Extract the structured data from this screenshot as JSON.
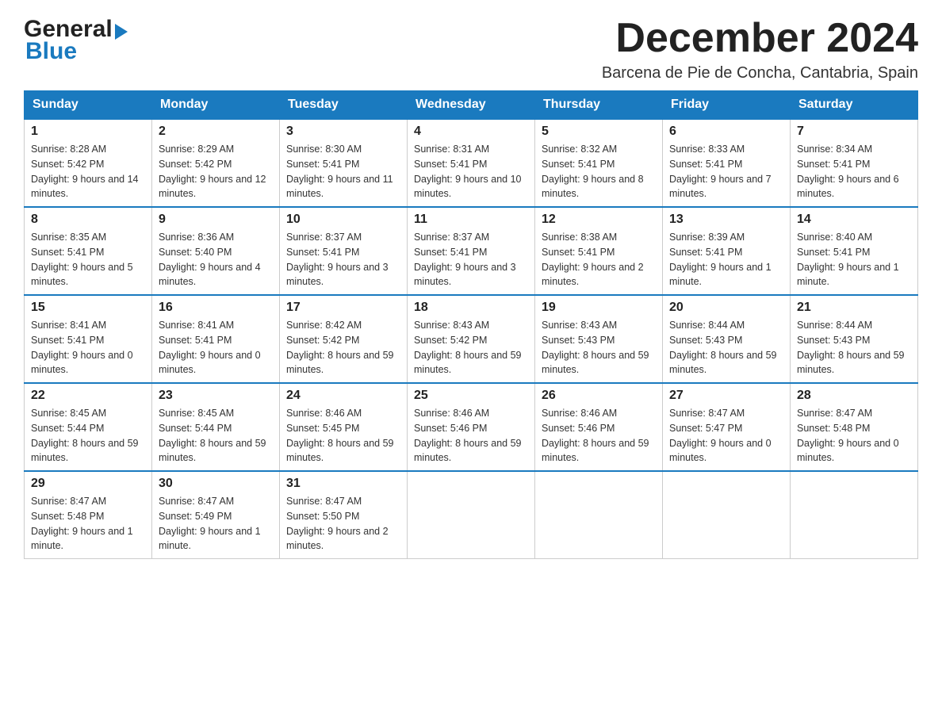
{
  "header": {
    "logo_general": "General",
    "logo_blue": "Blue",
    "month_title": "December 2024",
    "location": "Barcena de Pie de Concha, Cantabria, Spain"
  },
  "days_of_week": [
    "Sunday",
    "Monday",
    "Tuesday",
    "Wednesday",
    "Thursday",
    "Friday",
    "Saturday"
  ],
  "weeks": [
    [
      {
        "day": "1",
        "sunrise": "8:28 AM",
        "sunset": "5:42 PM",
        "daylight": "9 hours and 14 minutes."
      },
      {
        "day": "2",
        "sunrise": "8:29 AM",
        "sunset": "5:42 PM",
        "daylight": "9 hours and 12 minutes."
      },
      {
        "day": "3",
        "sunrise": "8:30 AM",
        "sunset": "5:41 PM",
        "daylight": "9 hours and 11 minutes."
      },
      {
        "day": "4",
        "sunrise": "8:31 AM",
        "sunset": "5:41 PM",
        "daylight": "9 hours and 10 minutes."
      },
      {
        "day": "5",
        "sunrise": "8:32 AM",
        "sunset": "5:41 PM",
        "daylight": "9 hours and 8 minutes."
      },
      {
        "day": "6",
        "sunrise": "8:33 AM",
        "sunset": "5:41 PM",
        "daylight": "9 hours and 7 minutes."
      },
      {
        "day": "7",
        "sunrise": "8:34 AM",
        "sunset": "5:41 PM",
        "daylight": "9 hours and 6 minutes."
      }
    ],
    [
      {
        "day": "8",
        "sunrise": "8:35 AM",
        "sunset": "5:41 PM",
        "daylight": "9 hours and 5 minutes."
      },
      {
        "day": "9",
        "sunrise": "8:36 AM",
        "sunset": "5:40 PM",
        "daylight": "9 hours and 4 minutes."
      },
      {
        "day": "10",
        "sunrise": "8:37 AM",
        "sunset": "5:41 PM",
        "daylight": "9 hours and 3 minutes."
      },
      {
        "day": "11",
        "sunrise": "8:37 AM",
        "sunset": "5:41 PM",
        "daylight": "9 hours and 3 minutes."
      },
      {
        "day": "12",
        "sunrise": "8:38 AM",
        "sunset": "5:41 PM",
        "daylight": "9 hours and 2 minutes."
      },
      {
        "day": "13",
        "sunrise": "8:39 AM",
        "sunset": "5:41 PM",
        "daylight": "9 hours and 1 minute."
      },
      {
        "day": "14",
        "sunrise": "8:40 AM",
        "sunset": "5:41 PM",
        "daylight": "9 hours and 1 minute."
      }
    ],
    [
      {
        "day": "15",
        "sunrise": "8:41 AM",
        "sunset": "5:41 PM",
        "daylight": "9 hours and 0 minutes."
      },
      {
        "day": "16",
        "sunrise": "8:41 AM",
        "sunset": "5:41 PM",
        "daylight": "9 hours and 0 minutes."
      },
      {
        "day": "17",
        "sunrise": "8:42 AM",
        "sunset": "5:42 PM",
        "daylight": "8 hours and 59 minutes."
      },
      {
        "day": "18",
        "sunrise": "8:43 AM",
        "sunset": "5:42 PM",
        "daylight": "8 hours and 59 minutes."
      },
      {
        "day": "19",
        "sunrise": "8:43 AM",
        "sunset": "5:43 PM",
        "daylight": "8 hours and 59 minutes."
      },
      {
        "day": "20",
        "sunrise": "8:44 AM",
        "sunset": "5:43 PM",
        "daylight": "8 hours and 59 minutes."
      },
      {
        "day": "21",
        "sunrise": "8:44 AM",
        "sunset": "5:43 PM",
        "daylight": "8 hours and 59 minutes."
      }
    ],
    [
      {
        "day": "22",
        "sunrise": "8:45 AM",
        "sunset": "5:44 PM",
        "daylight": "8 hours and 59 minutes."
      },
      {
        "day": "23",
        "sunrise": "8:45 AM",
        "sunset": "5:44 PM",
        "daylight": "8 hours and 59 minutes."
      },
      {
        "day": "24",
        "sunrise": "8:46 AM",
        "sunset": "5:45 PM",
        "daylight": "8 hours and 59 minutes."
      },
      {
        "day": "25",
        "sunrise": "8:46 AM",
        "sunset": "5:46 PM",
        "daylight": "8 hours and 59 minutes."
      },
      {
        "day": "26",
        "sunrise": "8:46 AM",
        "sunset": "5:46 PM",
        "daylight": "8 hours and 59 minutes."
      },
      {
        "day": "27",
        "sunrise": "8:47 AM",
        "sunset": "5:47 PM",
        "daylight": "9 hours and 0 minutes."
      },
      {
        "day": "28",
        "sunrise": "8:47 AM",
        "sunset": "5:48 PM",
        "daylight": "9 hours and 0 minutes."
      }
    ],
    [
      {
        "day": "29",
        "sunrise": "8:47 AM",
        "sunset": "5:48 PM",
        "daylight": "9 hours and 1 minute."
      },
      {
        "day": "30",
        "sunrise": "8:47 AM",
        "sunset": "5:49 PM",
        "daylight": "9 hours and 1 minute."
      },
      {
        "day": "31",
        "sunrise": "8:47 AM",
        "sunset": "5:50 PM",
        "daylight": "9 hours and 2 minutes."
      },
      null,
      null,
      null,
      null
    ]
  ]
}
